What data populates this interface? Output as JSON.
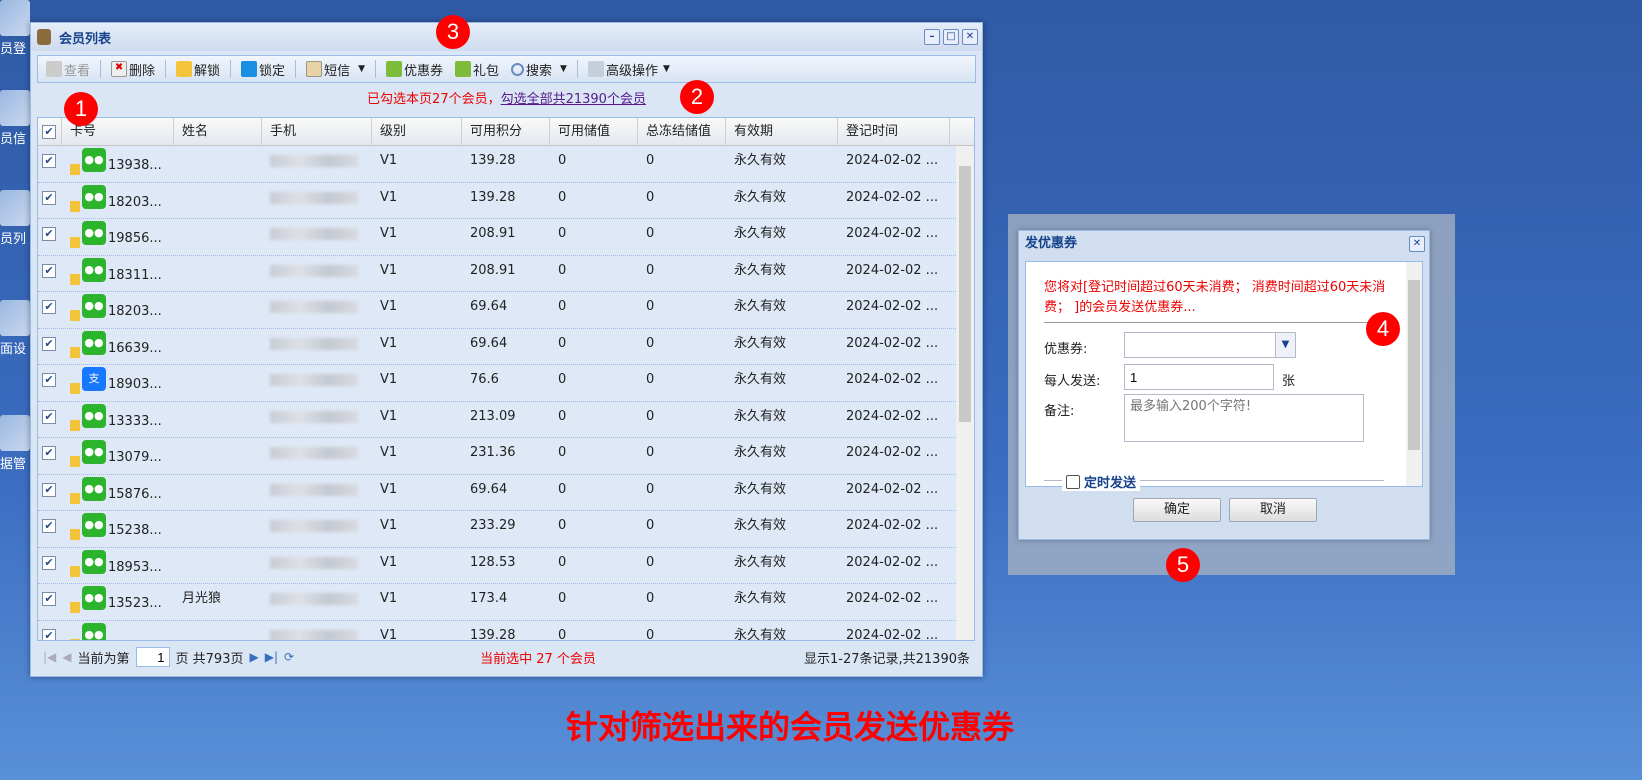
{
  "desktop": {
    "icons": [
      "员登",
      "员信",
      "员列",
      "面设",
      "据管"
    ]
  },
  "window": {
    "title": "会员列表"
  },
  "toolbar": {
    "view": "查看",
    "delete": "删除",
    "unlock": "解锁",
    "lock": "锁定",
    "sms": "短信",
    "coupon": "优惠券",
    "gift": "礼包",
    "search": "搜索",
    "advanced": "高级操作"
  },
  "notice": {
    "selected": "已勾选本页27个会员，",
    "select_all": "勾选全部共21390个会员"
  },
  "grid": {
    "columns": [
      "卡号",
      "姓名",
      "手机",
      "级别",
      "可用积分",
      "可用储值",
      "总冻结储值",
      "有效期",
      "登记时间"
    ],
    "rows": [
      {
        "card": "13938...",
        "icon": "wechat",
        "name": "",
        "level": "V1",
        "points": "139.28",
        "balance": "0",
        "frozen": "0",
        "validity": "永久有效",
        "reg": "2024-02-02 ..."
      },
      {
        "card": "18203...",
        "icon": "wechat",
        "name": "",
        "level": "V1",
        "points": "139.28",
        "balance": "0",
        "frozen": "0",
        "validity": "永久有效",
        "reg": "2024-02-02 ..."
      },
      {
        "card": "19856...",
        "icon": "wechat",
        "name": "",
        "level": "V1",
        "points": "208.91",
        "balance": "0",
        "frozen": "0",
        "validity": "永久有效",
        "reg": "2024-02-02 ..."
      },
      {
        "card": "18311...",
        "icon": "wechat",
        "name": "",
        "level": "V1",
        "points": "208.91",
        "balance": "0",
        "frozen": "0",
        "validity": "永久有效",
        "reg": "2024-02-02 ..."
      },
      {
        "card": "18203...",
        "icon": "wechat",
        "name": "",
        "level": "V1",
        "points": "69.64",
        "balance": "0",
        "frozen": "0",
        "validity": "永久有效",
        "reg": "2024-02-02 ..."
      },
      {
        "card": "16639...",
        "icon": "wechat",
        "name": "",
        "level": "V1",
        "points": "69.64",
        "balance": "0",
        "frozen": "0",
        "validity": "永久有效",
        "reg": "2024-02-02 ..."
      },
      {
        "card": "18903...",
        "icon": "alipay",
        "name": "",
        "level": "V1",
        "points": "76.6",
        "balance": "0",
        "frozen": "0",
        "validity": "永久有效",
        "reg": "2024-02-02 ..."
      },
      {
        "card": "13333...",
        "icon": "wechat",
        "name": "",
        "level": "V1",
        "points": "213.09",
        "balance": "0",
        "frozen": "0",
        "validity": "永久有效",
        "reg": "2024-02-02 ..."
      },
      {
        "card": "13079...",
        "icon": "wechat",
        "name": "",
        "level": "V1",
        "points": "231.36",
        "balance": "0",
        "frozen": "0",
        "validity": "永久有效",
        "reg": "2024-02-02 ..."
      },
      {
        "card": "15876...",
        "icon": "wechat",
        "name": "",
        "level": "V1",
        "points": "69.64",
        "balance": "0",
        "frozen": "0",
        "validity": "永久有效",
        "reg": "2024-02-02 ..."
      },
      {
        "card": "15238...",
        "icon": "wechat",
        "name": "",
        "level": "V1",
        "points": "233.29",
        "balance": "0",
        "frozen": "0",
        "validity": "永久有效",
        "reg": "2024-02-02 ..."
      },
      {
        "card": "18953...",
        "icon": "wechat",
        "name": "",
        "level": "V1",
        "points": "128.53",
        "balance": "0",
        "frozen": "0",
        "validity": "永久有效",
        "reg": "2024-02-02 ..."
      },
      {
        "card": "13523...",
        "icon": "wechat",
        "name": "月光狼",
        "level": "V1",
        "points": "173.4",
        "balance": "0",
        "frozen": "0",
        "validity": "永久有效",
        "reg": "2024-02-02 ..."
      },
      {
        "card": "",
        "icon": "wechat",
        "name": "",
        "level": "V1",
        "points": "139.28",
        "balance": "0",
        "frozen": "0",
        "validity": "永久有效",
        "reg": "2024-02-02 ..."
      }
    ]
  },
  "pager": {
    "prefix": "当前为第",
    "page": "1",
    "suffix": "页 共793页",
    "selected": "当前选中 27 个会员",
    "summary": "显示1-27条记录,共21390条"
  },
  "dialog": {
    "title": "发优惠券",
    "message": "您将对[登记时间超过60天未消费； 消费时间超过60天未消费； ]的会员发送优惠券...",
    "coupon_label": "优惠券:",
    "coupon_value": "",
    "per_label": "每人发送:",
    "per_value": "1",
    "per_unit": "张",
    "remark_label": "备注:",
    "remark_placeholder": "最多输入200个字符!",
    "scheduled_label": "定时发送",
    "scheduled_checked": false,
    "ok": "确定",
    "cancel": "取消"
  },
  "markers": [
    "1",
    "2",
    "3",
    "4",
    "5"
  ],
  "caption": "针对筛选出来的会员发送优惠券",
  "colors": {
    "accent": "#15428b",
    "alert": "#ff0000",
    "row_selected": "#dfe8f6"
  }
}
